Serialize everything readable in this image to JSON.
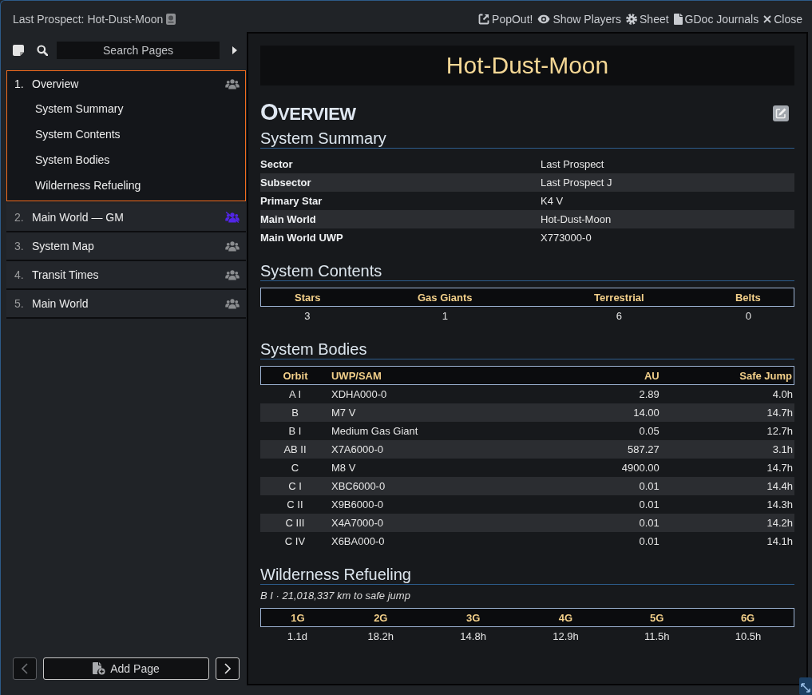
{
  "window": {
    "title": "Last Prospect: Hot-Dust-Moon"
  },
  "header_controls": [
    {
      "kind": "popout",
      "label": "PopOut!"
    },
    {
      "kind": "show_players",
      "label": "Show Players"
    },
    {
      "kind": "sheet",
      "label": "Sheet"
    },
    {
      "kind": "journals",
      "label": "GDoc Journals"
    },
    {
      "kind": "close",
      "label": "Close"
    }
  ],
  "sidebar": {
    "search": {
      "placeholder": "Search Pages"
    },
    "pages": [
      {
        "number": "1.",
        "title": "Overview",
        "selected": true,
        "expanded": true,
        "hidden": false,
        "children": [
          {
            "title": "System Summary"
          },
          {
            "title": "System Contents"
          },
          {
            "title": "System Bodies"
          },
          {
            "title": "Wilderness Refueling"
          }
        ]
      },
      {
        "number": "2.",
        "title": "Main World — GM",
        "selected": false,
        "expanded": false,
        "hidden": true
      },
      {
        "number": "3.",
        "title": "System Map",
        "selected": false,
        "expanded": false,
        "hidden": false
      },
      {
        "number": "4.",
        "title": "Transit Times",
        "selected": false,
        "expanded": false,
        "hidden": false
      },
      {
        "number": "5.",
        "title": "Main World",
        "selected": false,
        "expanded": false,
        "hidden": false
      }
    ],
    "add_page": "Add Page"
  },
  "page": {
    "title": "Hot-Dust-Moon",
    "heading": "OVERVIEW",
    "sections": [
      {
        "kind": "summary",
        "title": "System Summary",
        "rows": [
          {
            "key": "Sector",
            "value": "Last Prospect"
          },
          {
            "key": "Subsector",
            "value": "Last Prospect J"
          },
          {
            "key": "Primary Star",
            "value": "K4 V"
          },
          {
            "key": "Main World",
            "value": "Hot-Dust-Moon"
          },
          {
            "key": "Main World UWP",
            "value": "X773000-0"
          }
        ]
      },
      {
        "kind": "table",
        "title": "System Contents",
        "columns": [
          {
            "label": "Stars",
            "kind": "count"
          },
          {
            "label": "Gas Giants",
            "kind": "count"
          },
          {
            "label": "Terrestrial",
            "kind": "count"
          },
          {
            "label": "Belts",
            "kind": "count"
          }
        ],
        "rows": [
          [
            "3",
            "1",
            "6",
            "0"
          ]
        ]
      },
      {
        "kind": "table",
        "title": "System Bodies",
        "columns": [
          {
            "label": "Orbit",
            "kind": "id"
          },
          {
            "label": "UWP/SAM",
            "kind": "name"
          },
          {
            "label": "AU",
            "kind": "number"
          },
          {
            "label": "Safe Jump",
            "kind": "number"
          }
        ],
        "rows": [
          [
            "A I",
            "XDHA000-0",
            "2.89",
            "4.0h"
          ],
          [
            "B",
            "M7 V",
            "14.00",
            "14.7h"
          ],
          [
            "B I",
            "Medium Gas Giant",
            "0.05",
            "12.7h"
          ],
          [
            "AB II",
            "X7A6000-0",
            "587.27",
            "3.1h"
          ],
          [
            "C",
            "M8 V",
            "4900.00",
            "14.7h"
          ],
          [
            "C I",
            "XBC6000-0",
            "0.01",
            "14.4h"
          ],
          [
            "C II",
            "X9B6000-0",
            "0.01",
            "14.3h"
          ],
          [
            "C III",
            "X4A7000-0",
            "0.01",
            "14.2h"
          ],
          [
            "C IV",
            "X6BA000-0",
            "0.01",
            "14.1h"
          ]
        ]
      },
      {
        "kind": "table",
        "title": "Wilderness Refueling",
        "note": "B I · 21,018,337 km to safe jump",
        "columns": [
          {
            "label": "1G",
            "kind": "duration"
          },
          {
            "label": "2G",
            "kind": "duration"
          },
          {
            "label": "3G",
            "kind": "duration"
          },
          {
            "label": "4G",
            "kind": "duration"
          },
          {
            "label": "5G",
            "kind": "duration"
          },
          {
            "label": "6G",
            "kind": "duration"
          }
        ],
        "rows": [
          [
            "1.1d",
            "18.2h",
            "14.8h",
            "12.9h",
            "11.5h",
            "10.5h"
          ]
        ]
      }
    ]
  }
}
